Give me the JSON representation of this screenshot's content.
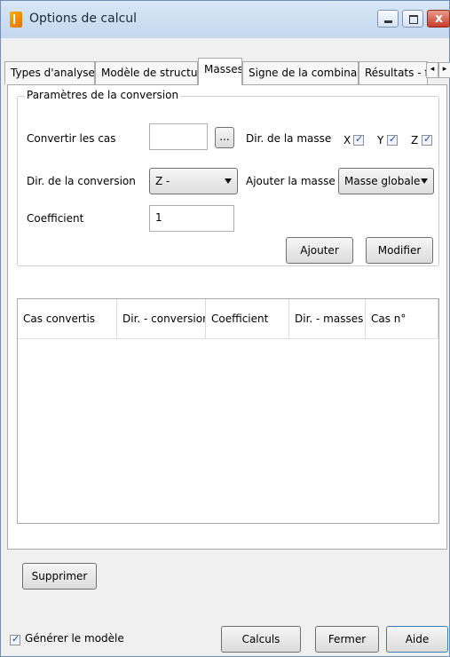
{
  "window": {
    "title": "Options de calcul"
  },
  "titlebar_buttons": {
    "minimize": "minimize-icon",
    "maximize": "maximize-icon",
    "close": "close-icon"
  },
  "tabs": [
    {
      "label": "Types d'analyse",
      "active": false
    },
    {
      "label": "Modèle de structure",
      "active": false
    },
    {
      "label": "Masses",
      "active": true
    },
    {
      "label": "Signe de la combinaison",
      "active": false
    },
    {
      "label": "Résultats - fil",
      "active": false
    }
  ],
  "tab_scroll": {
    "left": "◂",
    "right": "▸"
  },
  "conversion": {
    "group_title": "Paramètres de la conversion",
    "convert_cases_label": "Convertir les cas",
    "convert_cases_value": "",
    "browse_label": "...",
    "mass_dir_label": "Dir. de la masse",
    "mass_dir": [
      {
        "axis": "X",
        "checked": true
      },
      {
        "axis": "Y",
        "checked": true
      },
      {
        "axis": "Z",
        "checked": true
      }
    ],
    "conversion_dir_label": "Dir. de la conversion",
    "conversion_dir_value": "Z -",
    "add_mass_to_label": "Ajouter la masse à",
    "add_mass_to_value": "Masse globale",
    "coefficient_label": "Coefficient",
    "coefficient_value": "1",
    "add_button": "Ajouter",
    "modify_button": "Modifier"
  },
  "table": {
    "columns": [
      "Cas convertis",
      "Dir. - conversion",
      "Coefficient",
      "Dir. - masses",
      "Cas n°"
    ],
    "rows": []
  },
  "delete_button": "Supprimer",
  "footer": {
    "generate_model_label": "Générer le modèle",
    "generate_model_checked": true,
    "calc_button": "Calculs",
    "close_button": "Fermer",
    "help_button": "Aide"
  }
}
